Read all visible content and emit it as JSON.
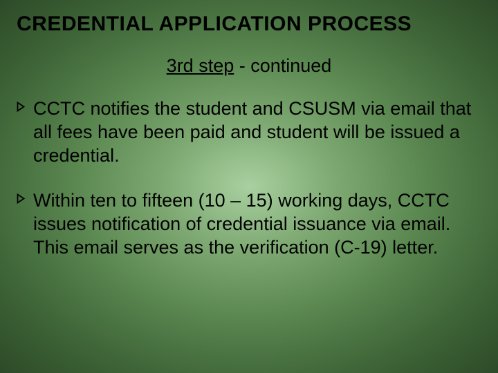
{
  "title": "CREDENTIAL APPLICATION PROCESS",
  "subtitle_underlined": "3rd step",
  "subtitle_rest": " - continued",
  "bullets": [
    "CCTC notifies the student and CSUSM via email that all fees have been paid and student will be issued a credential.",
    "Within ten to fifteen (10 – 15) working days, CCTC issues notification of credential issuance via email. This email serves as the verification (C-19) letter."
  ]
}
